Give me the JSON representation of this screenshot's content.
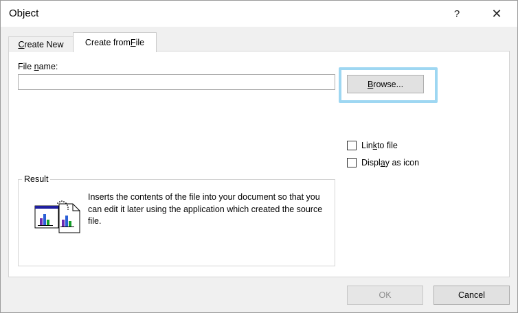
{
  "dialog": {
    "title": "Object",
    "help_label": "?",
    "close_label": "✕"
  },
  "tabs": [
    {
      "label_pre": "",
      "label_ul": "C",
      "label_post": "reate New",
      "selected": false
    },
    {
      "label_pre": "Create from ",
      "label_ul": "F",
      "label_post": "ile",
      "selected": true
    }
  ],
  "filename": {
    "label_pre": "File ",
    "label_ul": "n",
    "label_post": "ame:",
    "value": "",
    "placeholder": ""
  },
  "browse": {
    "label_ul": "B",
    "label_post": "rowse..."
  },
  "options": {
    "link": {
      "label_pre": "Lin",
      "label_ul": "k",
      "label_post": " to file",
      "checked": false
    },
    "icon": {
      "label_pre": "Displ",
      "label_ul": "a",
      "label_post": "y as icon",
      "checked": false
    }
  },
  "result": {
    "legend": "Result",
    "text": "Inserts the contents of the file into your document so that you can edit it later using the application which created the source file."
  },
  "buttons": {
    "ok": "OK",
    "cancel": "Cancel"
  },
  "colors": {
    "highlight": "#9ed7f2",
    "panel": "#ffffff",
    "chrome": "#f0f0f0"
  }
}
